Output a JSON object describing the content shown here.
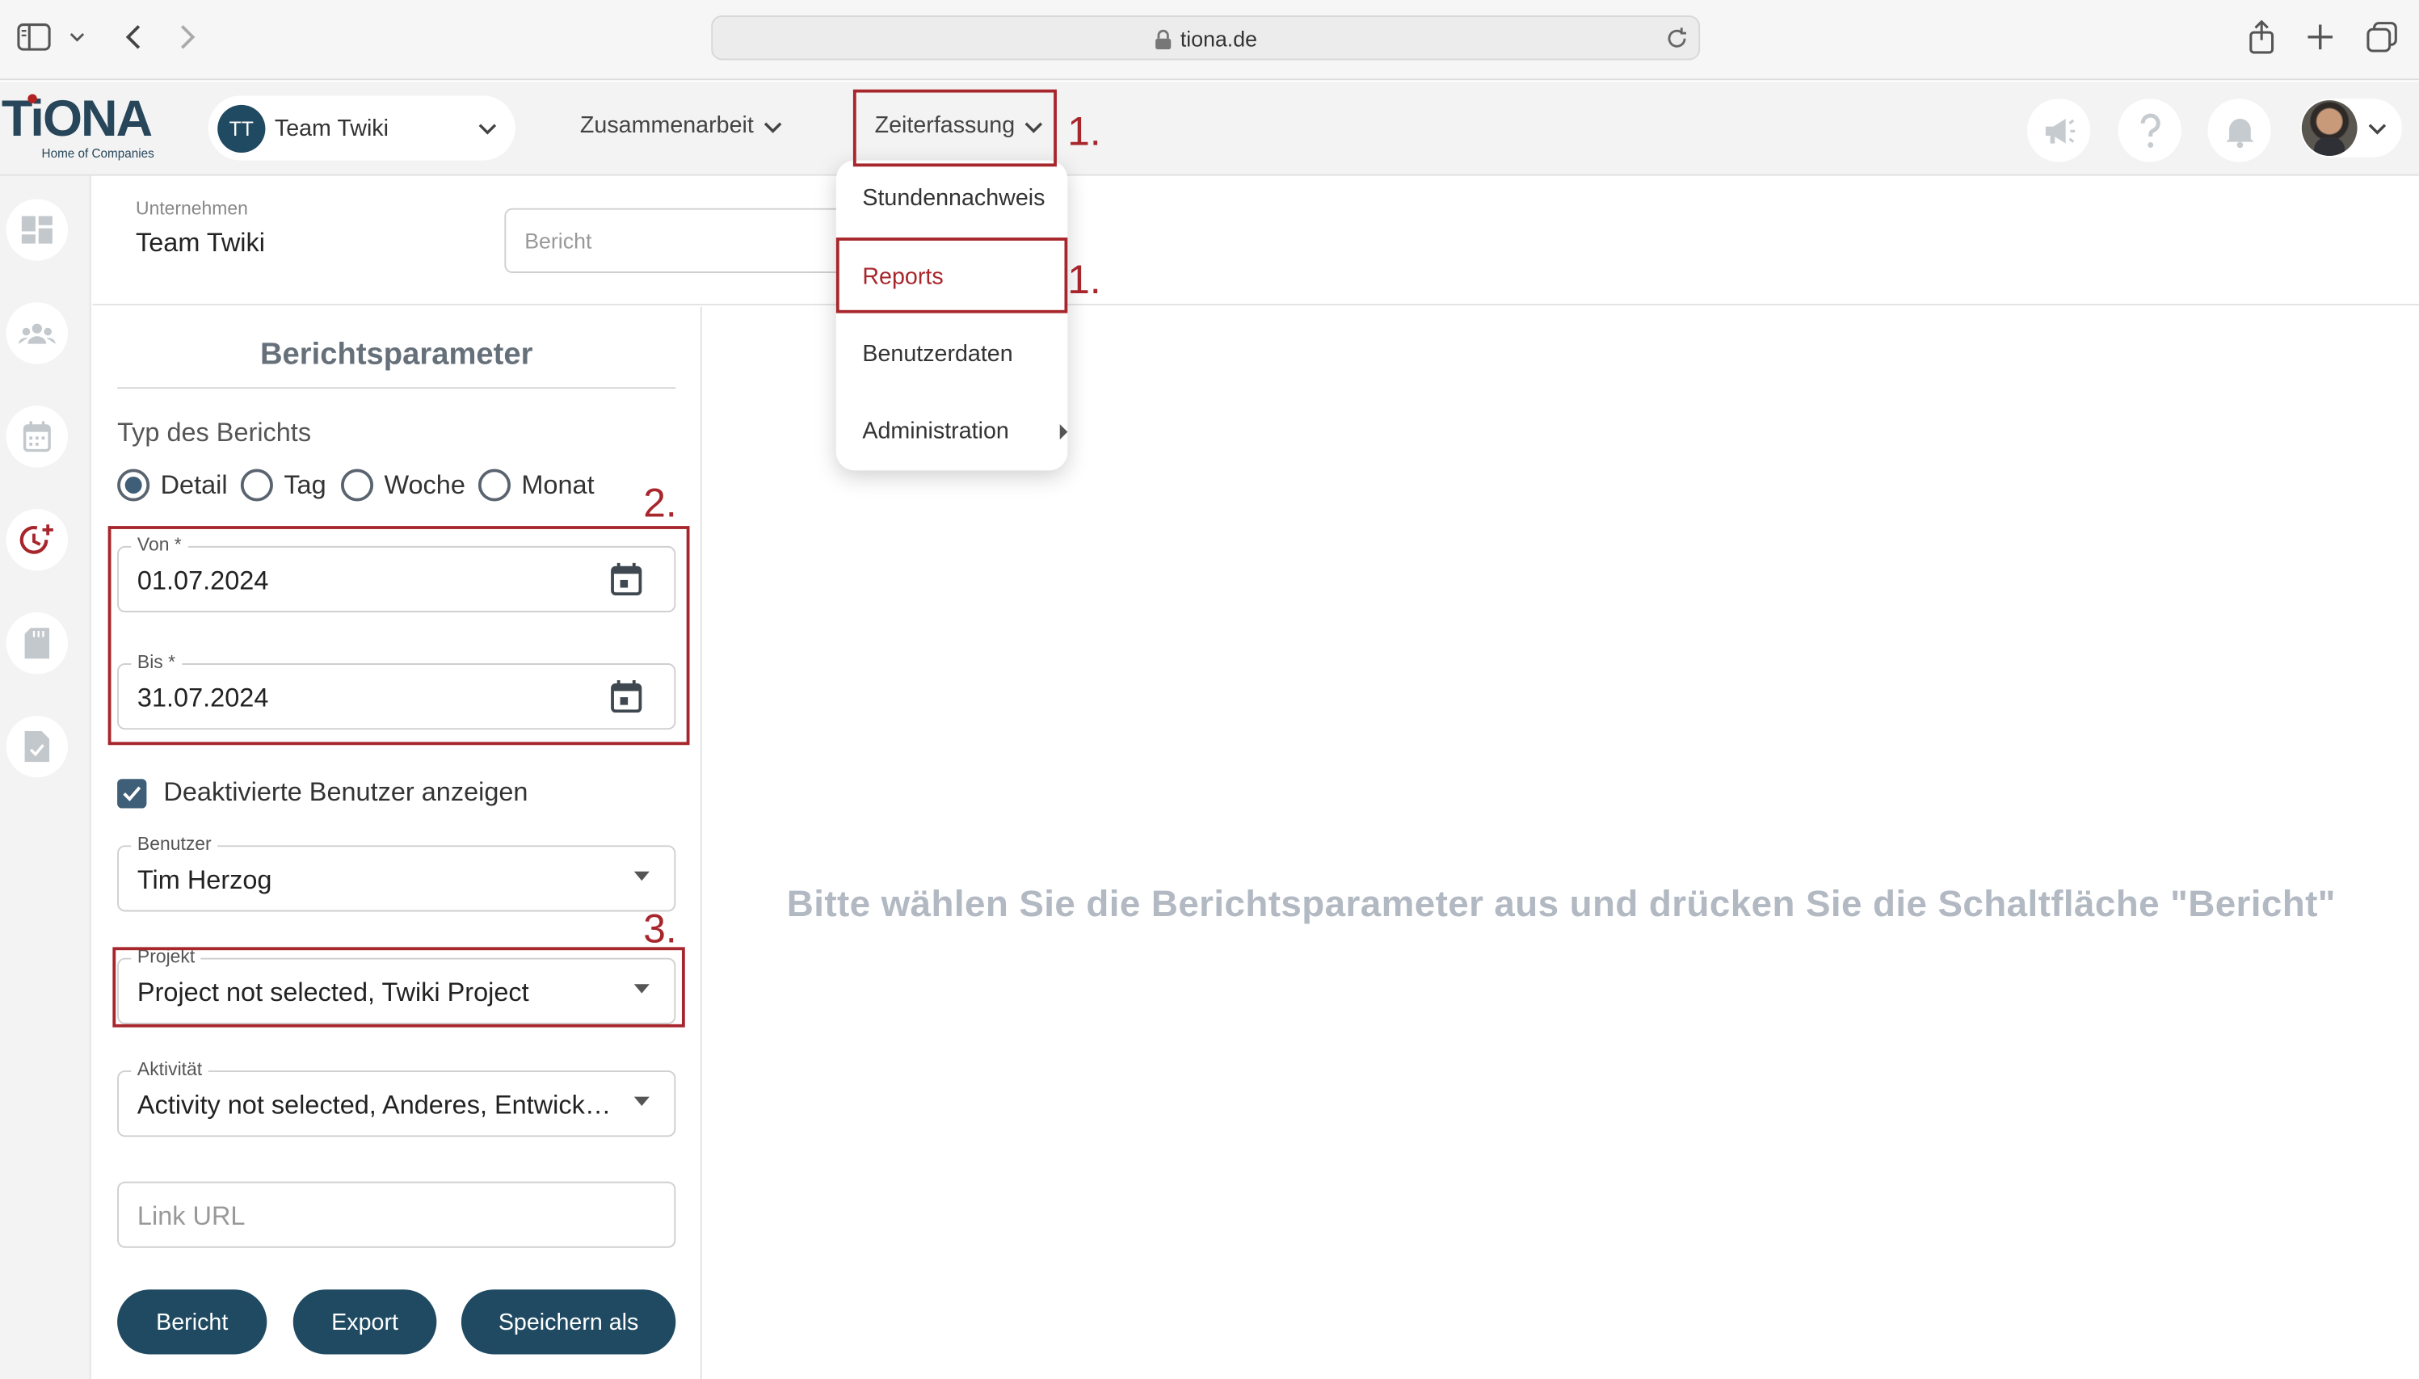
{
  "browser": {
    "url": "tiona.de"
  },
  "app": {
    "logo_text": "TiONA",
    "logo_tagline": "Home of Companies",
    "team": {
      "initials": "TT",
      "name": "Team Twiki"
    },
    "nav": {
      "collaboration": "Zusammenarbeit",
      "time_tracking": "Zeiterfassung"
    }
  },
  "menu": {
    "items": [
      {
        "label": "Stundennachweis"
      },
      {
        "label": "Reports"
      },
      {
        "label": "Benutzerdaten"
      },
      {
        "label": "Administration"
      }
    ]
  },
  "company": {
    "label": "Unternehmen",
    "value": "Team Twiki",
    "report_placeholder": "Bericht"
  },
  "params": {
    "title": "Berichtsparameter",
    "type_label": "Typ des Berichts",
    "types": [
      {
        "label": "Detail",
        "selected": true
      },
      {
        "label": "Tag",
        "selected": false
      },
      {
        "label": "Woche",
        "selected": false
      },
      {
        "label": "Monat",
        "selected": false
      }
    ],
    "from": {
      "label": "Von *",
      "value": "01.07.2024"
    },
    "to": {
      "label": "Bis *",
      "value": "31.07.2024"
    },
    "show_deactivated": {
      "label": "Deaktivierte Benutzer anzeigen",
      "checked": true
    },
    "user": {
      "label": "Benutzer",
      "value": "Tim Herzog"
    },
    "project": {
      "label": "Projekt",
      "value": "Project not selected, Twiki Project"
    },
    "activity": {
      "label": "Aktivität",
      "value": "Activity not selected, Anderes, Entwicklung"
    },
    "link_url": {
      "placeholder": "Link URL"
    },
    "buttons": {
      "report": "Bericht",
      "export": "Export",
      "save_as": "Speichern als"
    }
  },
  "content": {
    "empty_message": "Bitte wählen Sie die Berichtsparameter aus und drücken Sie die Schaltfläche \"Bericht\""
  },
  "annotations": {
    "step1": "1.",
    "step2": "2.",
    "step3": "3."
  },
  "colors": {
    "primary": "#1f4a62",
    "annotation": "#a7262c",
    "muted_text": "#b2b9c2"
  }
}
